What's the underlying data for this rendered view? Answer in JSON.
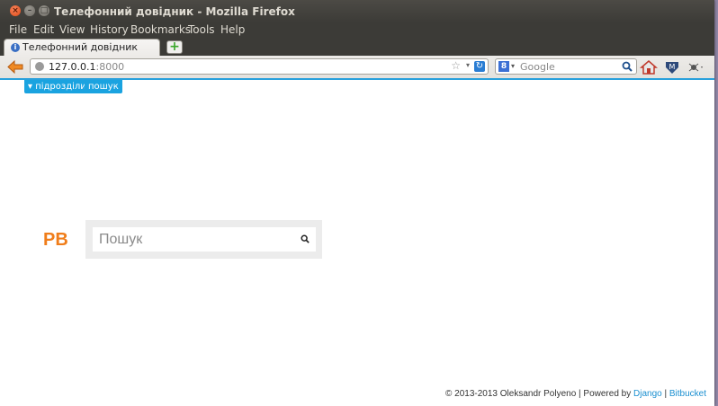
{
  "window": {
    "title": "Телефонний довідник - Mozilla Firefox",
    "close_glyph": "×",
    "min_glyph": "–",
    "max_glyph": "□"
  },
  "menubar": {
    "items": [
      "File",
      "Edit",
      "View",
      "History",
      "Bookmarks",
      "Tools",
      "Help"
    ]
  },
  "tabs": [
    {
      "title": "Телефонний довідник",
      "active": true
    }
  ],
  "new_tab_glyph": "+",
  "navbar": {
    "url_host": "127.0.0.1",
    "url_port": ":8000",
    "search_engine": "Google",
    "search_engine_badge": "8",
    "star_glyph": "☆",
    "dropdown_glyph": "▾",
    "reload_glyph": "↻"
  },
  "page": {
    "top_links": [
      "▾ підрозділи",
      "пошук"
    ],
    "logo": "PB",
    "search_placeholder": "Пошук",
    "footer": {
      "text": "© 2013-2013 Oleksandr Polyeno | Powered by ",
      "link1": "Django",
      "separator": " | ",
      "link2": "Bitbucket"
    }
  },
  "colors": {
    "accent": "#1aa3e0",
    "logo": "#f07d1a",
    "titlebar": "#3c3b37",
    "link": "#1a8fd0"
  }
}
